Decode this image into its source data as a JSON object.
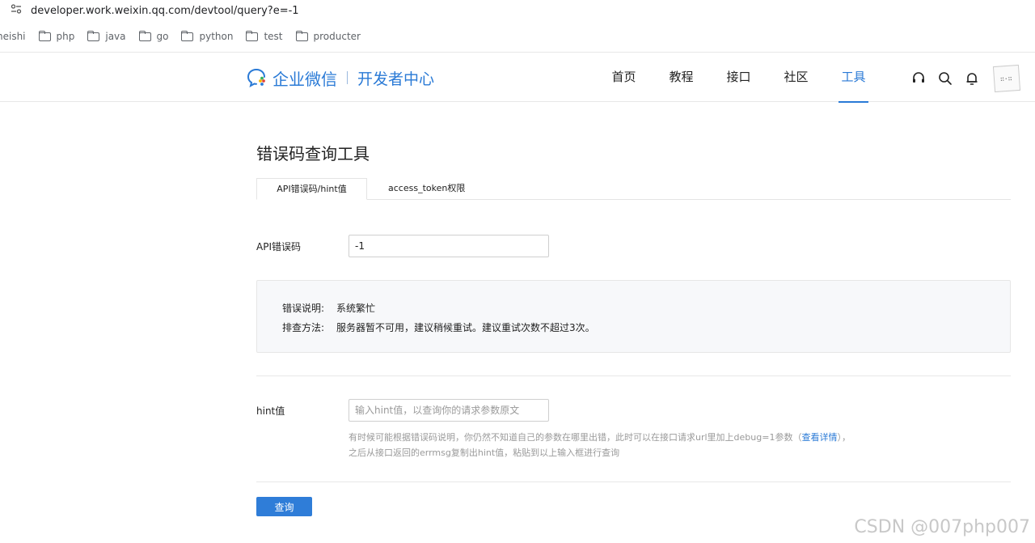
{
  "browser": {
    "url": "developer.work.weixin.qq.com/devtool/query?e=-1",
    "bookmarks": [
      "neishi",
      "php",
      "java",
      "go",
      "python",
      "test",
      "producter"
    ]
  },
  "header": {
    "brand": "企业微信",
    "subtitle": "开发者中心",
    "nav": [
      "首页",
      "教程",
      "接口",
      "社区",
      "工具"
    ],
    "active_nav": "工具",
    "icons": [
      "headset-icon",
      "search-icon",
      "bell-icon",
      "avatar"
    ]
  },
  "page": {
    "title": "错误码查询工具",
    "tabs": [
      "API错误码/hint值",
      "access_token权限"
    ],
    "error_code": {
      "label": "API错误码",
      "value": "-1"
    },
    "result": {
      "desc_label": "错误说明:",
      "desc_value": "系统繁忙",
      "method_label": "排查方法:",
      "method_value": "服务器暂不可用，建议稍候重试。建议重试次数不超过3次。"
    },
    "hint": {
      "label": "hint值",
      "placeholder": "输入hint值，以查询你的请求参数原文",
      "help_line1_pre": "有时候可能根据错误码说明，你仍然不知道自己的参数在哪里出错，此时可以在接口请求url里加上debug=1参数（",
      "help_link": "查看详情",
      "help_line1_post": "），",
      "help_line2": "之后从接口返回的errmsg复制出hint值，粘贴到以上输入框进行查询"
    },
    "submit_label": "查询"
  },
  "watermark": "CSDN @007php007",
  "colors": {
    "accent": "#2a7ad6",
    "button": "#2f7dd8",
    "result_bg": "#f7f8fa"
  }
}
